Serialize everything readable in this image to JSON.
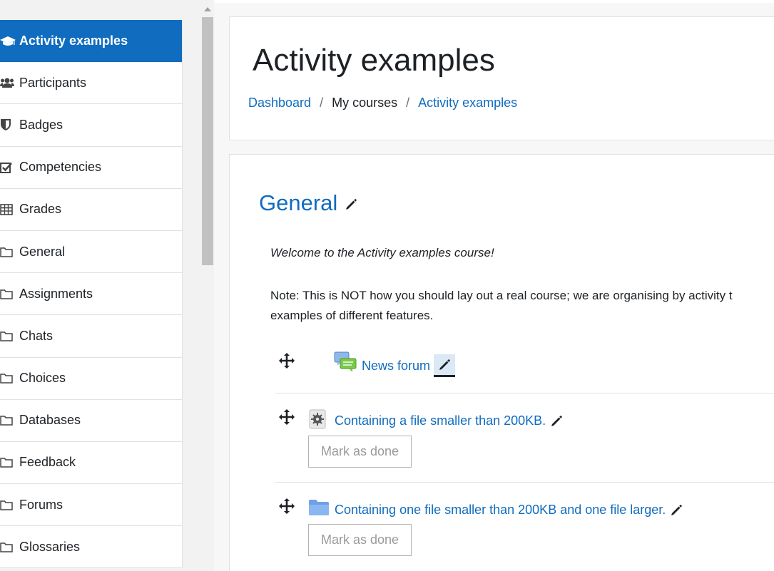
{
  "sidebar": {
    "items": [
      {
        "label": "Activity examples",
        "icon": "graduation-cap-icon",
        "active": true
      },
      {
        "label": "Participants",
        "icon": "users-icon"
      },
      {
        "label": "Badges",
        "icon": "shield-icon"
      },
      {
        "label": "Competencies",
        "icon": "checkbox-icon"
      },
      {
        "label": "Grades",
        "icon": "table-icon"
      },
      {
        "label": "General",
        "icon": "folder-icon"
      },
      {
        "label": "Assignments",
        "icon": "folder-icon"
      },
      {
        "label": "Chats",
        "icon": "folder-icon"
      },
      {
        "label": "Choices",
        "icon": "folder-icon"
      },
      {
        "label": "Databases",
        "icon": "folder-icon"
      },
      {
        "label": "Feedback",
        "icon": "folder-icon"
      },
      {
        "label": "Forums",
        "icon": "folder-icon"
      },
      {
        "label": "Glossaries",
        "icon": "folder-icon"
      }
    ]
  },
  "header": {
    "title": "Activity examples",
    "breadcrumb": {
      "dashboard": "Dashboard",
      "separator": "/",
      "my_courses": "My courses",
      "current": "Activity examples"
    }
  },
  "section": {
    "title": "General",
    "welcome": "Welcome to the Activity examples course!",
    "note_line1": "Note: This is NOT how you should lay out a real course; we are organising by activity t",
    "note_line2": "examples of different features."
  },
  "activities": [
    {
      "name": "News forum",
      "icon": "forum-icon"
    },
    {
      "name": "Containing a file smaller than 200KB.",
      "icon": "file-icon",
      "button": "Mark as done"
    },
    {
      "name": "Containing one file smaller than 200KB and one file larger.",
      "icon": "folder-icon",
      "button": "Mark as done"
    }
  ],
  "colors": {
    "accent": "#0f6cbf",
    "active_bg": "#0f6cbf",
    "text": "#1d2125"
  }
}
